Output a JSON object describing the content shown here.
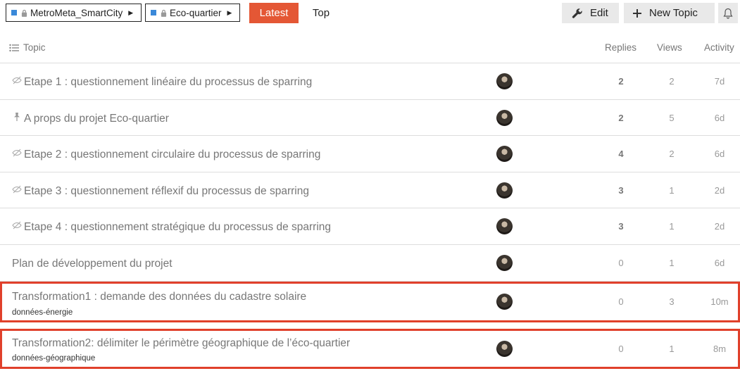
{
  "nav": {
    "breadcrumbs": [
      {
        "label": "MetroMeta_SmartCity",
        "color": "#3a89d9"
      },
      {
        "label": "Eco-quartier",
        "color": "#3a89d9"
      }
    ],
    "tabs": [
      {
        "label": "Latest",
        "active": true
      },
      {
        "label": "Top",
        "active": false
      }
    ],
    "edit_label": "Edit",
    "new_topic_label": "New Topic"
  },
  "columns": {
    "topic": "Topic",
    "replies": "Replies",
    "views": "Views",
    "activity": "Activity"
  },
  "topics": [
    {
      "icon": "unlisted-icon",
      "title": "Etape 1 : questionnement linéaire du processus de sparring",
      "tag": "",
      "replies": "2",
      "views": "2",
      "activity": "7d"
    },
    {
      "icon": "pin-icon",
      "title": "A props du projet Eco-quartier",
      "tag": "",
      "replies": "2",
      "views": "5",
      "activity": "6d"
    },
    {
      "icon": "unlisted-icon",
      "title": "Etape 2 : questionnement circulaire du processus de sparring",
      "tag": "",
      "replies": "4",
      "views": "2",
      "activity": "6d"
    },
    {
      "icon": "unlisted-icon",
      "title": "Etape 3 : questionnement réflexif du processus de sparring",
      "tag": "",
      "replies": "3",
      "views": "1",
      "activity": "2d"
    },
    {
      "icon": "unlisted-icon",
      "title": "Etape 4 : questionnement stratégique du processus de sparring",
      "tag": "",
      "replies": "3",
      "views": "1",
      "activity": "2d"
    },
    {
      "icon": "",
      "title": "Plan de développement du projet",
      "tag": "",
      "replies": "0",
      "views": "1",
      "activity": "6d"
    },
    {
      "icon": "",
      "title": "Transformation1 : demande des données du cadastre solaire",
      "tag": "données-énergie",
      "replies": "0",
      "views": "3",
      "activity": "10m"
    },
    {
      "icon": "",
      "title": "Transformation2: délimiter le périmètre géographique de l’éco-quartier",
      "tag": "données-géographique",
      "replies": "0",
      "views": "1",
      "activity": "8m"
    }
  ],
  "colors": {
    "accent": "#e45735",
    "category": "#3a89d9",
    "highlight": "#e0402b"
  }
}
